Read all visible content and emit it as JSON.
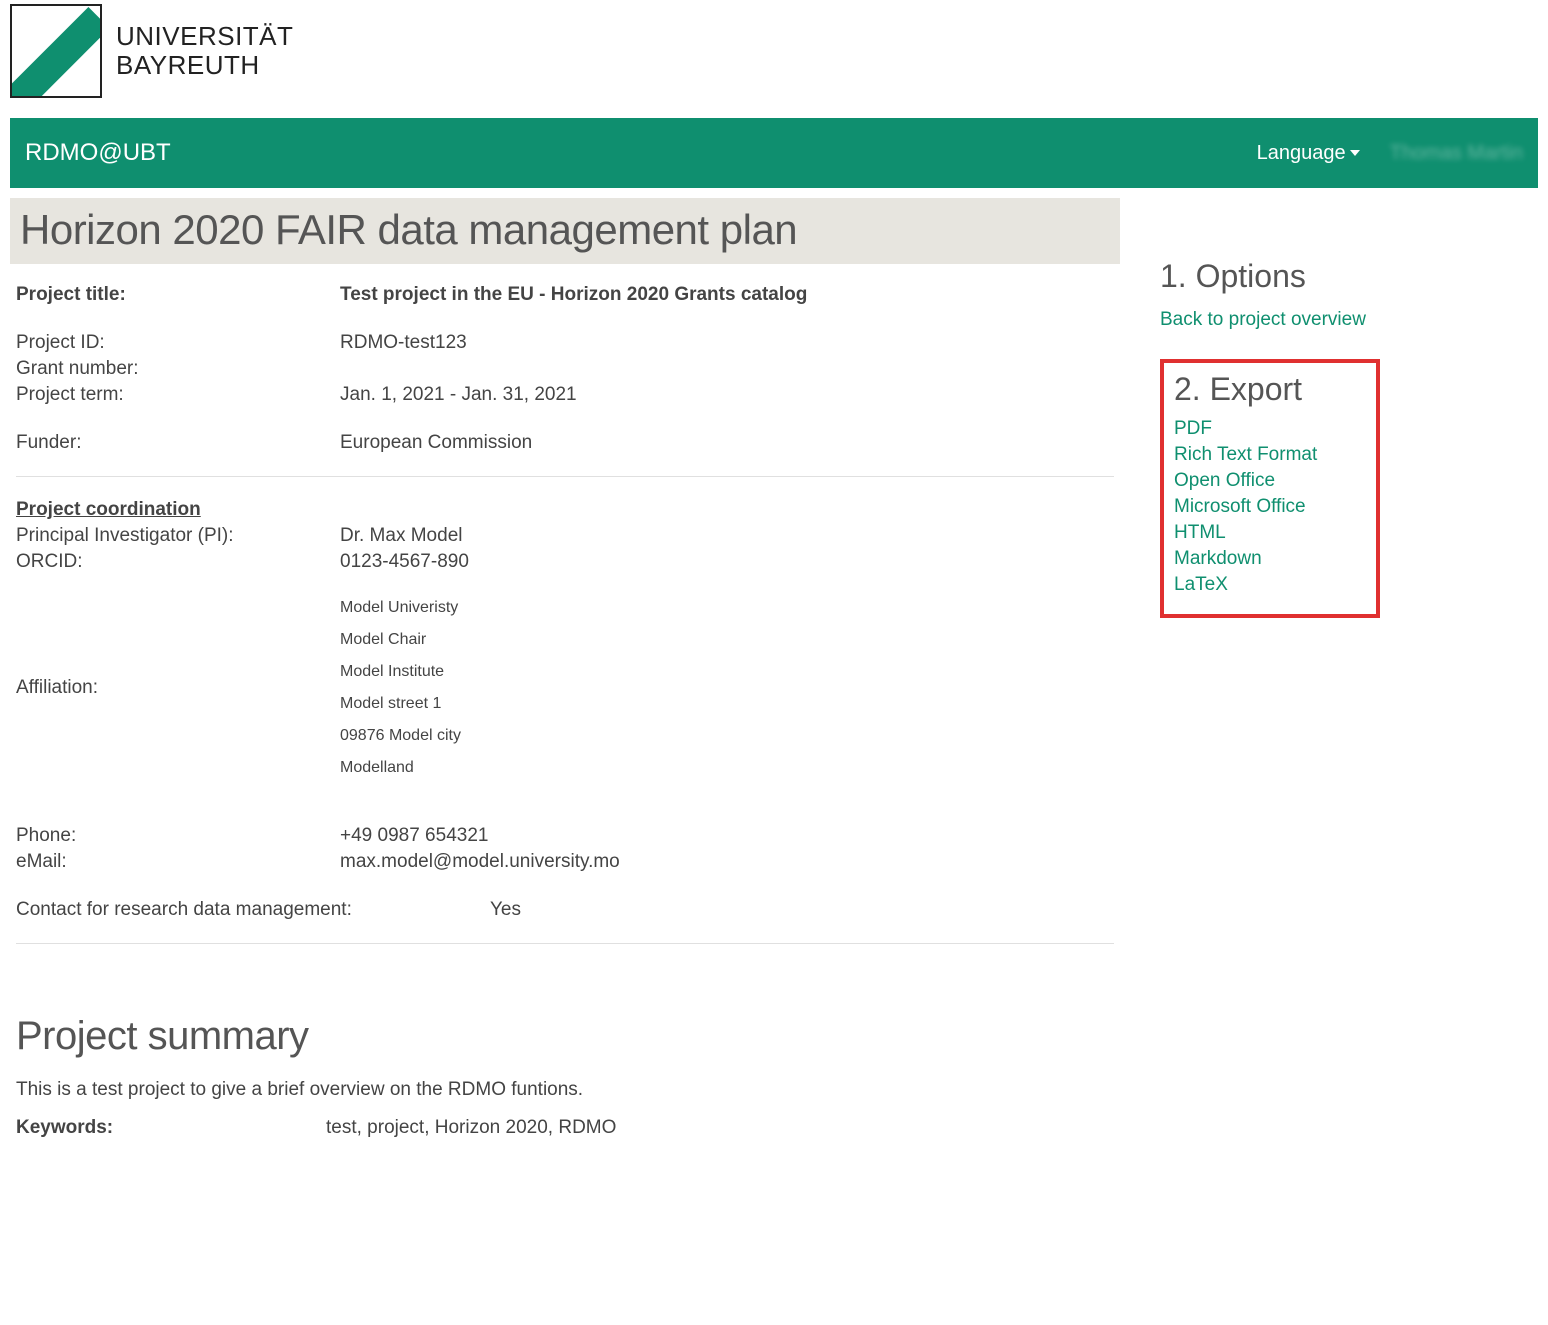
{
  "logo": {
    "line1": "UNIVERSITÄT",
    "line2": "BAYREUTH"
  },
  "navbar": {
    "brand": "RDMO@UBT",
    "language_label": "Language",
    "user_placeholder": "Thomas Martin"
  },
  "page_title": "Horizon 2020 FAIR data management plan",
  "project": {
    "title_label": "Project title:",
    "title_value": "Test project in the EU - Horizon 2020 Grants catalog",
    "id_label": "Project ID:",
    "id_value": "RDMO-test123",
    "grant_label": "Grant number:",
    "grant_value": "",
    "term_label": "Project term:",
    "term_value": "Jan. 1, 2021 - Jan. 31, 2021",
    "funder_label": "Funder:",
    "funder_value": "European Commission"
  },
  "coordination": {
    "heading": "Project coordination",
    "pi_label": "Principal Investigator (PI):",
    "pi_value": "Dr. Max Model",
    "orcid_label": "ORCID:",
    "orcid_value": "0123-4567-890",
    "affiliation_label": "Affiliation:",
    "affiliation": {
      "uni": "Model Univeristy",
      "chair": "Model Chair",
      "institute": "Model Institute",
      "street": "Model street 1",
      "city": "09876 Model city",
      "country": "Modelland"
    },
    "phone_label": "Phone:",
    "phone_value": "+49 0987 654321",
    "email_label": "eMail:",
    "email_value": "max.model@model.university.mo",
    "contact_rdm_label": "Contact for research data management:",
    "contact_rdm_value": "Yes"
  },
  "summary": {
    "heading": "Project summary",
    "body": "This is a test project to give a brief overview on the RDMO funtions.",
    "keywords_label": "Keywords:",
    "keywords_value": "test, project, Horizon 2020, RDMO"
  },
  "sidebar": {
    "options_heading": "1.  Options",
    "back_link": "Back to project overview",
    "export_heading": "2.  Export",
    "export_formats": [
      "PDF",
      "Rich Text Format",
      "Open Office",
      "Microsoft Office",
      "HTML",
      "Markdown",
      "LaTeX"
    ]
  }
}
